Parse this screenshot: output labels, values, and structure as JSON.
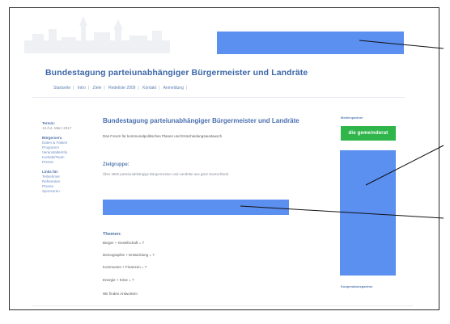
{
  "header": {
    "site_title": "Bundestagung parteiunabhängiger Bürgermeister und Landräte",
    "nav": [
      "Startseite",
      "Intro",
      "Ziele",
      "Redeliste 2009",
      "Kontakt",
      "Anmeldung"
    ]
  },
  "left": {
    "date_label": "Termin:",
    "date_value": "13./14. März 2017",
    "organizer_label": "Bürgerserv.",
    "organizer_lines": [
      "Daten & Fakten",
      "Programm",
      "Veranstalterinfo",
      "Kontakt/Team",
      "Presse"
    ],
    "links_label": "Links für:",
    "links": [
      "Teilnehmer",
      "Referenten",
      "Presse",
      "Sponsoren"
    ]
  },
  "main": {
    "title": "Bundestagung parteiunabhängiger Bürgermeister und Landräte",
    "subtitle": "Das Forum für kommunalpolitisches Planen und Entscheidungsaustausch",
    "section_heading": "Zielgruppe:",
    "section_text": "Über 4500 parteiunabhängige Bürgermeister und Landräte aus ganz Deutschland",
    "themes_heading": "Themen:",
    "themes": [
      "Bürger + Gesellschaft = ?",
      "Demographie + Entwicklung = ?",
      "Kommunen + Finanzen = ?",
      "Energie + Krise = ?",
      "Wir finden Antworten!"
    ]
  },
  "right": {
    "top_label": "Medienpartner",
    "badge": "die gemeinderat",
    "bottom_label": "Kooperationspartner"
  },
  "colors": {
    "placeholder_blue": "#5b8ff0",
    "brand_green": "#2fb54a",
    "title_blue": "#3d67a8"
  }
}
